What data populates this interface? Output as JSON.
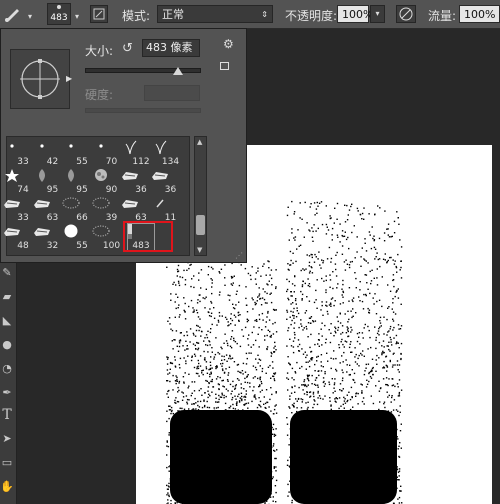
{
  "options_bar": {
    "brush_size": "483",
    "mode_label": "模式:",
    "mode_value": "正常",
    "opacity_label": "不透明度:",
    "opacity_value": "100%",
    "flow_label": "流量:",
    "flow_value": "100%"
  },
  "brush_picker": {
    "size_label": "大小:",
    "size_value": "483 像素",
    "size_slider_fraction": 0.82,
    "hardness_label": "硬度:",
    "gear_icon": "gear-icon",
    "brushes": [
      {
        "size": "33",
        "shape": "dot"
      },
      {
        "size": "42",
        "shape": "dot"
      },
      {
        "size": "55",
        "shape": "dot"
      },
      {
        "size": "70",
        "shape": "dot"
      },
      {
        "size": "112",
        "shape": "grass"
      },
      {
        "size": "134",
        "shape": "grass"
      },
      {
        "size": "74",
        "shape": "star"
      },
      {
        "size": "95",
        "shape": "leaf"
      },
      {
        "size": "95",
        "shape": "leaf"
      },
      {
        "size": "90",
        "shape": "texture"
      },
      {
        "size": "36",
        "shape": "chalk"
      },
      {
        "size": "36",
        "shape": "chalk"
      },
      {
        "size": "33",
        "shape": "chalk"
      },
      {
        "size": "63",
        "shape": "chalk"
      },
      {
        "size": "66",
        "shape": "spray"
      },
      {
        "size": "39",
        "shape": "spray"
      },
      {
        "size": "63",
        "shape": "chalk"
      },
      {
        "size": "11",
        "shape": "stroke"
      },
      {
        "size": "48",
        "shape": "chalk"
      },
      {
        "size": "32",
        "shape": "chalk"
      },
      {
        "size": "55",
        "shape": "round"
      },
      {
        "size": "100",
        "shape": "spray"
      },
      {
        "size": "483",
        "shape": "tall",
        "selected": true
      }
    ],
    "selection_color": "#e0141b"
  }
}
